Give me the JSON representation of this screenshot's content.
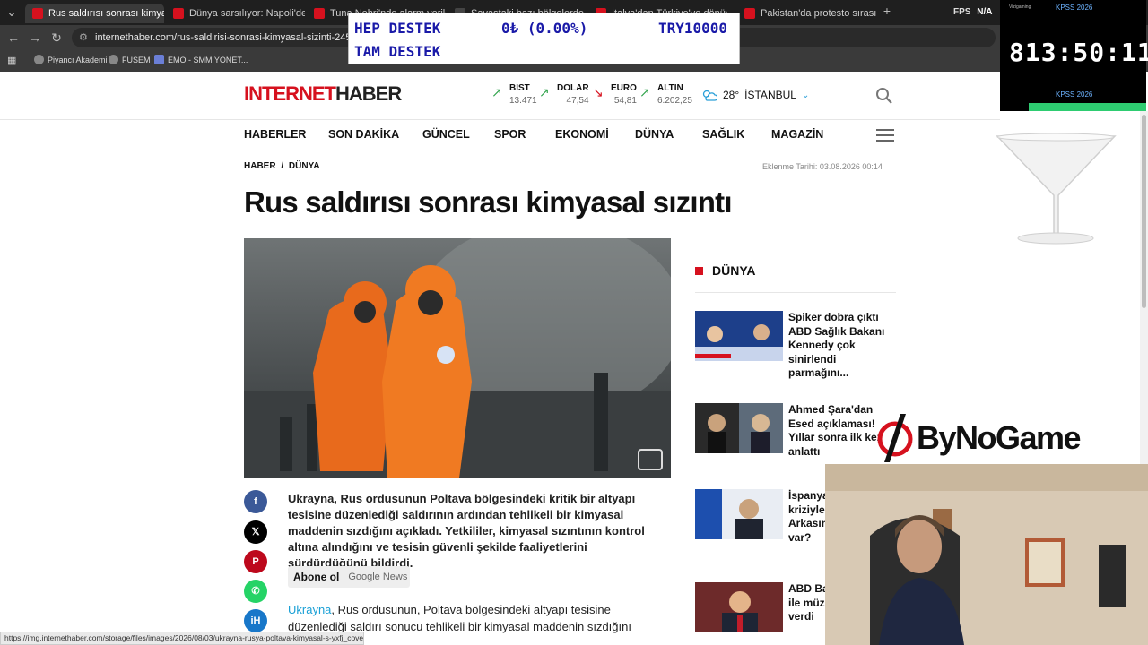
{
  "browser": {
    "tabs": [
      {
        "title": "Rus saldırısı sonrası kimyasal sız",
        "active": true,
        "color": "#d6111e"
      },
      {
        "title": "Dünya sarsılıyor: Napoli'de 40 yı",
        "active": false,
        "color": "#d6111e"
      },
      {
        "title": "Tuna Nehri'nde alarm verildi",
        "active": false,
        "color": "#d6111e"
      },
      {
        "title": "Savaştaki bazı bölgelerde hav",
        "active": false,
        "color": "#444"
      },
      {
        "title": "İtalya'dan Türkiye'ye dönüyor",
        "active": false,
        "color": "#d6111e"
      },
      {
        "title": "Pakistan'da protesto sırasında l",
        "active": false,
        "color": "#d6111e"
      }
    ],
    "url": "internethaber.com/rus-saldirisi-sonrasi-kimyasal-sizinti-2453645h.htm",
    "fps_label": "FPS",
    "fps_value": "N/A",
    "bookmarks": [
      "Piyancı Akademi",
      "FUSEM",
      "EMO - SMM YÖNET..."
    ],
    "status_url": "https://img.internethaber.com/storage/files/images/2026/08/03/ukrayna-rusya-poltava-kimyasal-s-yxfj_cover.jpg"
  },
  "overlay": {
    "ticker_line1_left": "HEP DESTEK",
    "ticker_line1_mid": "0₺ (0.00%)",
    "ticker_line1_right": "TRY10000",
    "ticker_line2": "TAM DESTEK",
    "timer_brand": "Vizigaming",
    "timer_label_top": "KPSS 2026",
    "timer_clock": "813:50:11",
    "timer_label_bottom": "KPSS 2026",
    "sponsor": "ByNoGame"
  },
  "site": {
    "logo_part1": "INTERNET",
    "logo_part2": "HABER",
    "markets": [
      {
        "name": "BIST",
        "value": "13.471",
        "trend": "up"
      },
      {
        "name": "DOLAR",
        "value": "47,54",
        "trend": "up"
      },
      {
        "name": "EURO",
        "value": "54,81",
        "trend": "down"
      },
      {
        "name": "ALTIN",
        "value": "6.202,25",
        "trend": "up"
      }
    ],
    "weather_temp": "28°",
    "weather_city": "İSTANBUL",
    "nav": [
      "HABERLER",
      "SON DAKİKA",
      "GÜNCEL",
      "SPOR",
      "EKONOMİ",
      "DÜNYA",
      "SAĞLIK",
      "MAGAZİN"
    ]
  },
  "article": {
    "breadcrumb_root": "HABER",
    "breadcrumb_section": "DÜNYA",
    "date": "Eklenme Tarihi: 03.08.2026 00:14",
    "title": "Rus saldırısı sonrası kimyasal sızıntı",
    "lead": "Ukrayna, Rus ordusunun Poltava bölgesindeki kritik bir altyapı tesisine düzenlediği saldırının ardından tehlikeli bir kimyasal maddenin sızdığını açıkladı. Yetkililer, kimyasal sızıntının kontrol altına alındığını ve tesisin güvenli şekilde faaliyetlerini sürdürdüğünü bildirdi.",
    "subscribe_label": "Abone ol",
    "subscribe_service": "Google News",
    "body_link": "Ukrayna",
    "body_rest": ", Rus ordusunun, Poltava bölgesindeki altyapı tesisine düzenlediği saldırı sonucu tehlikeli bir kimyasal maddenin sızdığını bildirdi."
  },
  "sidebar": {
    "title": "DÜNYA",
    "items": [
      {
        "title": "Spiker dobra çıktı ABD Sağlık Bakanı Kennedy çok sinirlendi parmağını..."
      },
      {
        "title": "Ahmed Şara'dan Esed açıklaması! Yıllar sonra ilk kez anlattı"
      },
      {
        "title": "İspanya'da hükümet kriziyle ilgili Arkasında kim mu var?"
      },
      {
        "title": "ABD Başkanı Trump ile müzakere tarih verdi"
      }
    ]
  }
}
